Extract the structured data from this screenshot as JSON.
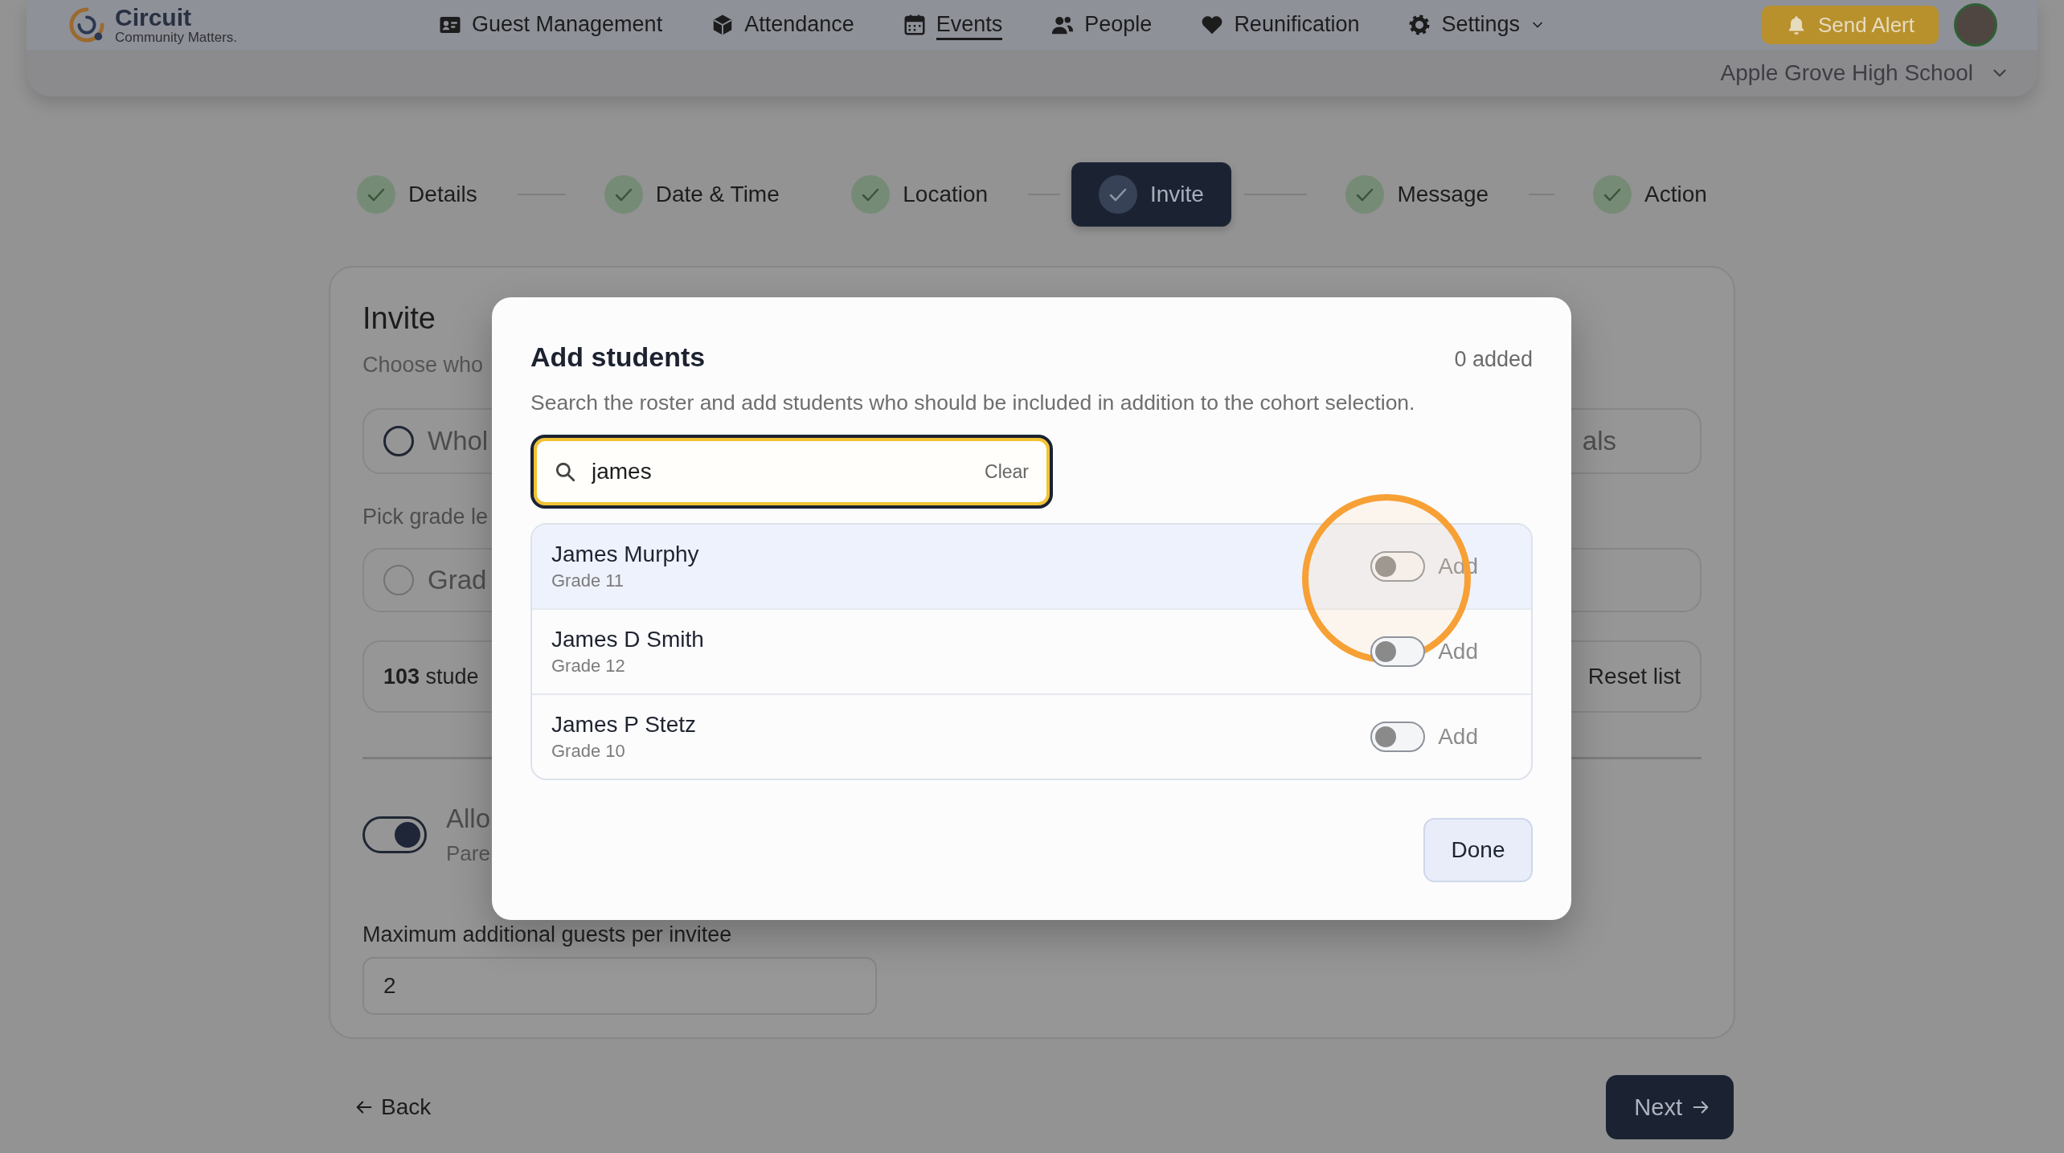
{
  "header": {
    "logo": {
      "name": "Circuit",
      "tagline": "Community Matters."
    },
    "nav": [
      {
        "label": "Guest Management",
        "selected": false,
        "dropdown": false
      },
      {
        "label": "Attendance",
        "selected": false,
        "dropdown": false
      },
      {
        "label": "Events",
        "selected": true,
        "dropdown": false
      },
      {
        "label": "People",
        "selected": false,
        "dropdown": false
      },
      {
        "label": "Reunification",
        "selected": false,
        "dropdown": false
      },
      {
        "label": "Settings",
        "selected": false,
        "dropdown": true
      }
    ],
    "alert_button": "Send Alert",
    "school": "Apple Grove High School"
  },
  "steps": [
    {
      "label": "Details",
      "completed": true,
      "selected": false
    },
    {
      "label": "Date & Time",
      "completed": true,
      "selected": false
    },
    {
      "label": "Location",
      "completed": true,
      "selected": false
    },
    {
      "label": "Invite",
      "completed": true,
      "selected": true
    },
    {
      "label": "Message",
      "completed": true,
      "selected": false
    },
    {
      "label": "Action",
      "completed": true,
      "selected": false
    }
  ],
  "invite_card": {
    "title": "Invite",
    "subtitle": "Choose who",
    "audience_options": [
      {
        "label": "Whol",
        "selected": false
      },
      {
        "label": "als"
      }
    ],
    "grade_prompt": "Pick grade le",
    "grade_option": {
      "label": "Grad",
      "selected": false,
      "disabled": true
    },
    "student_count": "**103** stude",
    "reset_button": "Reset list",
    "guest_toggle": {
      "label": "Allo",
      "hint": "Pare",
      "on": true
    },
    "max_guests": {
      "label": "Maximum additional guests per invitee",
      "value": "2"
    }
  },
  "modal": {
    "title": "Add students",
    "added_count": "0 added",
    "description": "Search the roster and add students who should be included in addition to the cohort selection.",
    "search": {
      "value": "james",
      "clear": "Clear"
    },
    "students": [
      {
        "name": "James Murphy",
        "grade": "Grade 11",
        "added": false,
        "action": "Add",
        "highlighted": true
      },
      {
        "name": "James D Smith",
        "grade": "Grade 12",
        "added": false,
        "action": "Add",
        "highlighted": false
      },
      {
        "name": "James P Stetz",
        "grade": "Grade 10",
        "added": false,
        "action": "Add",
        "highlighted": false
      }
    ],
    "done_button": "Done"
  },
  "footer": {
    "back": "Back",
    "next": "Next"
  }
}
